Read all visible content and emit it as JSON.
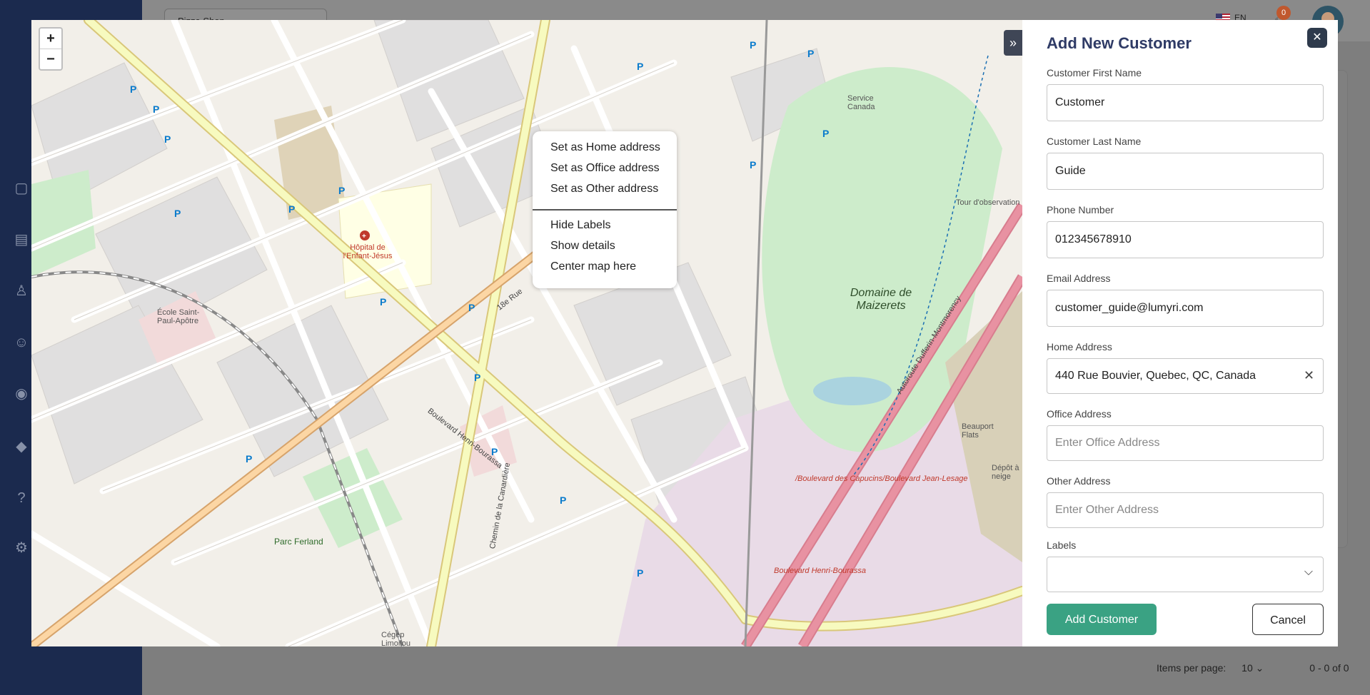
{
  "app": {
    "store_name": "Pizza Shop",
    "language": "EN",
    "notification_count": "0"
  },
  "paginator": {
    "items_per_page_label": "Items per page:",
    "page_size": "10",
    "range": "0 - 0 of 0"
  },
  "map": {
    "zoom_in": "+",
    "zoom_out": "−",
    "expand_icon": "»",
    "labels": {
      "hospital": "Hôpital de l'Enfant-Jésus",
      "domaine": "Domaine de Maizerets",
      "tour": "Tour d'observation",
      "parc_ferland": "Parc Ferland",
      "ecole": "École Saint-Paul-Apôtre",
      "beauport": "Beauport Flats",
      "depot": "Dépôt à neige",
      "service_canada": "Service Canada",
      "boul_henri": "Boulevard Henri-Bourassa",
      "boul_henri2": "Boulevard Henri-Bourassa",
      "capucins": "/Boulevard des Capucins/Boulevard Jean-Lesage",
      "cegep": "Cégep Limoilou",
      "autoroute": "Autoroute Dufferin-Montmorency",
      "chemin": "Chemin de la Canardière",
      "ave18": "18e Rue"
    },
    "context_menu": {
      "items": [
        "Set as Home address",
        "Set as Office address",
        "Set as Other address"
      ],
      "items2": [
        "Hide Labels",
        "Show details",
        "Center map here"
      ]
    }
  },
  "form": {
    "title": "Add New Customer",
    "first_name_label": "Customer First Name",
    "first_name_value": "Customer",
    "last_name_label": "Customer Last Name",
    "last_name_value": "Guide",
    "phone_label": "Phone Number",
    "phone_value": "012345678910",
    "email_label": "Email Address",
    "email_value": "customer_guide@lumyri.com",
    "home_label": "Home Address",
    "home_value": "440 Rue Bouvier, Quebec, QC, Canada",
    "office_label": "Office Address",
    "office_placeholder": "Enter Office Address",
    "other_label": "Other Address",
    "other_placeholder": "Enter Other Address",
    "labels_label": "Labels",
    "add_button": "Add Customer",
    "cancel_button": "Cancel"
  }
}
